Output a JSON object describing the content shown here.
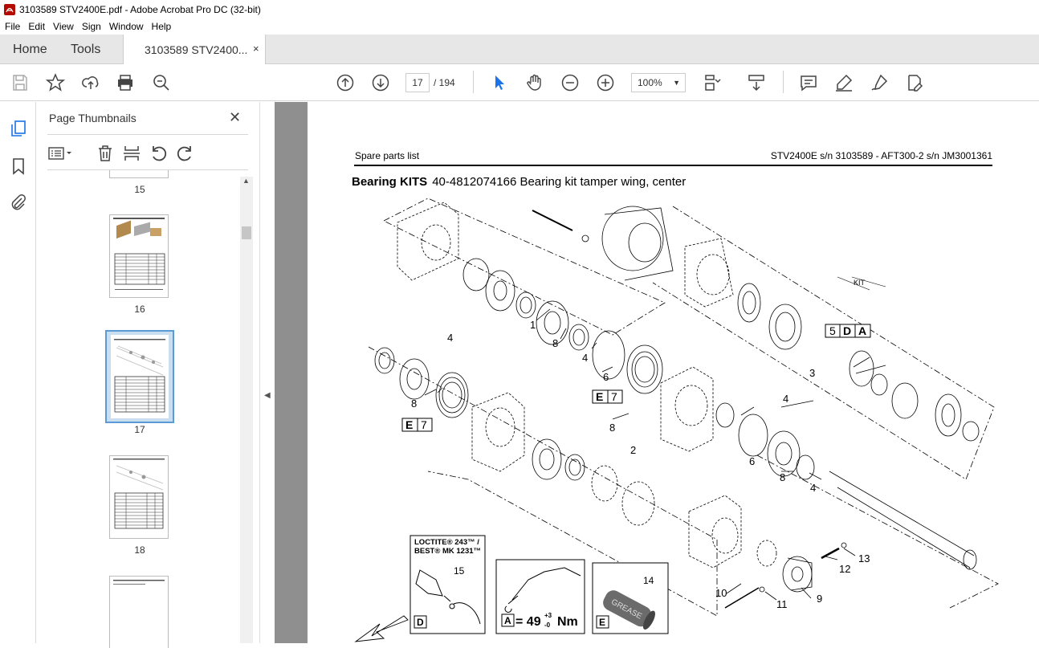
{
  "window": {
    "title": "3103589 STV2400E.pdf - Adobe Acrobat Pro DC (32-bit)"
  },
  "menu": [
    "File",
    "Edit",
    "View",
    "Sign",
    "Window",
    "Help"
  ],
  "tabs": {
    "home": "Home",
    "tools": "Tools",
    "document": "3103589 STV2400...",
    "close": "×"
  },
  "toolbar": {
    "current_page": "17",
    "total_pages": "/ 194",
    "zoom": "100%"
  },
  "thumb_panel": {
    "title": "Page Thumbnails",
    "close": "✕",
    "pages": [
      "15",
      "16",
      "17",
      "18"
    ],
    "selected_page": "17"
  },
  "document": {
    "header_left": "Spare parts list",
    "header_right": "STV2400E s/n 3103589 - AFT300-2 s/n JM3001361",
    "heading_bold": "Bearing KITS",
    "heading_rest": "40-4812074166 Bearing kit tamper wing, center",
    "kit_label": "KIT",
    "callouts": [
      "1",
      "8",
      "4",
      "6",
      "5",
      "D",
      "A",
      "3",
      "4",
      "8",
      "E",
      "7",
      "E",
      "7",
      "4",
      "8",
      "2",
      "6",
      "8",
      "4",
      "13",
      "12",
      "10",
      "11",
      "9"
    ],
    "legend": {
      "loctite_line1": "LOCTITE® 243™ /",
      "loctite_line2": "BEST® MK 1231™",
      "loctite_ref": "15",
      "loctite_tag": "D",
      "torque_tag": "A",
      "torque_value": "= 49",
      "torque_tol_plus": "+3",
      "torque_tol_minus": "-0",
      "torque_unit": "Nm",
      "grease_ref": "14",
      "grease_text": "GREASE",
      "grease_tag": "E"
    }
  }
}
